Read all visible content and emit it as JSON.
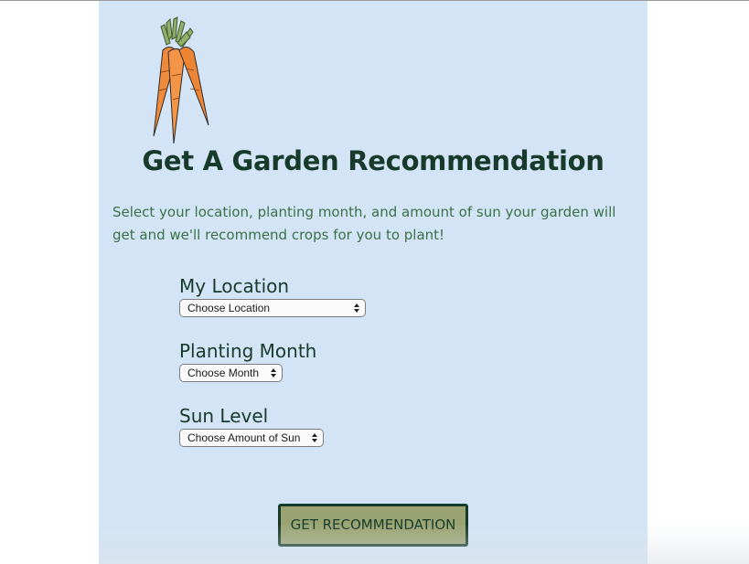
{
  "page": {
    "title": "Get A Garden Recommendation",
    "intro": "Select your location, planting month, and amount of sun your garden will get and we'll recommend crops for you to plant!"
  },
  "logo": {
    "icon": "carrots-icon"
  },
  "form": {
    "location": {
      "label": "My Location",
      "selected": "Choose Location"
    },
    "month": {
      "label": "Planting Month",
      "selected": "Choose Month"
    },
    "sun": {
      "label": "Sun Level",
      "selected": "Choose Amount of Sun"
    }
  },
  "submit": {
    "label": "GET RECOMMENDATION"
  },
  "colors": {
    "panel": "#d2e4f5",
    "heading": "#173a2a",
    "intro_text": "#3c7046",
    "button_fill": "#9aa472"
  }
}
